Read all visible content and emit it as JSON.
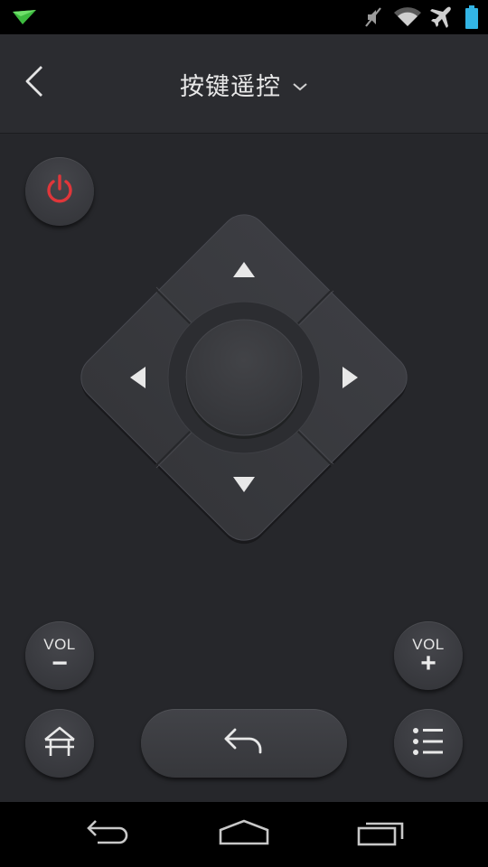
{
  "status_bar": {
    "icons": [
      "notification-paper-plane-icon",
      "mute-icon",
      "wifi-icon",
      "airplane-mode-icon",
      "battery-icon"
    ],
    "colors": {
      "notification": "#3dbb3f",
      "battery": "#33b5e5"
    }
  },
  "header": {
    "title": "按键遥控",
    "back_icon": "chevron-left-icon",
    "dropdown_icon": "chevron-down-icon"
  },
  "remote": {
    "power_icon": "power-icon",
    "power_color": "#e0363a",
    "dpad": {
      "up_icon": "arrow-up-icon",
      "down_icon": "arrow-down-icon",
      "left_icon": "arrow-left-icon",
      "right_icon": "arrow-right-icon",
      "center": "ok-button"
    },
    "vol_down": {
      "label": "VOL",
      "sign": "−"
    },
    "vol_up": {
      "label": "VOL",
      "sign": "+"
    },
    "home_icon": "home-icon",
    "back_icon": "return-arrow-icon",
    "menu_icon": "menu-list-icon"
  },
  "nav_bar": {
    "icons": [
      "nav-back-icon",
      "nav-home-icon",
      "nav-recents-icon"
    ]
  }
}
